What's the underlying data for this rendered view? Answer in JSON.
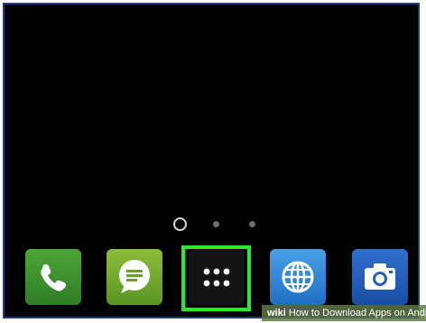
{
  "home_screen": {
    "page_indicator": {
      "pages": 3,
      "current_page": 1
    },
    "dock": {
      "apps": [
        {
          "name": "Phone",
          "icon": "phone-icon",
          "color": "#3c9431"
        },
        {
          "name": "Messages",
          "icon": "message-icon",
          "color": "#74aa2e"
        },
        {
          "name": "Apps",
          "icon": "app-drawer-icon",
          "color": "#141414",
          "highlighted": true
        },
        {
          "name": "Browser",
          "icon": "globe-icon",
          "color": "#3487d6"
        },
        {
          "name": "Camera",
          "icon": "camera-icon",
          "color": "#255fbd"
        }
      ],
      "highlight_color": "#2ee82e"
    }
  },
  "watermark": {
    "brand": "wiki",
    "text": "How to Download Apps on Android"
  }
}
